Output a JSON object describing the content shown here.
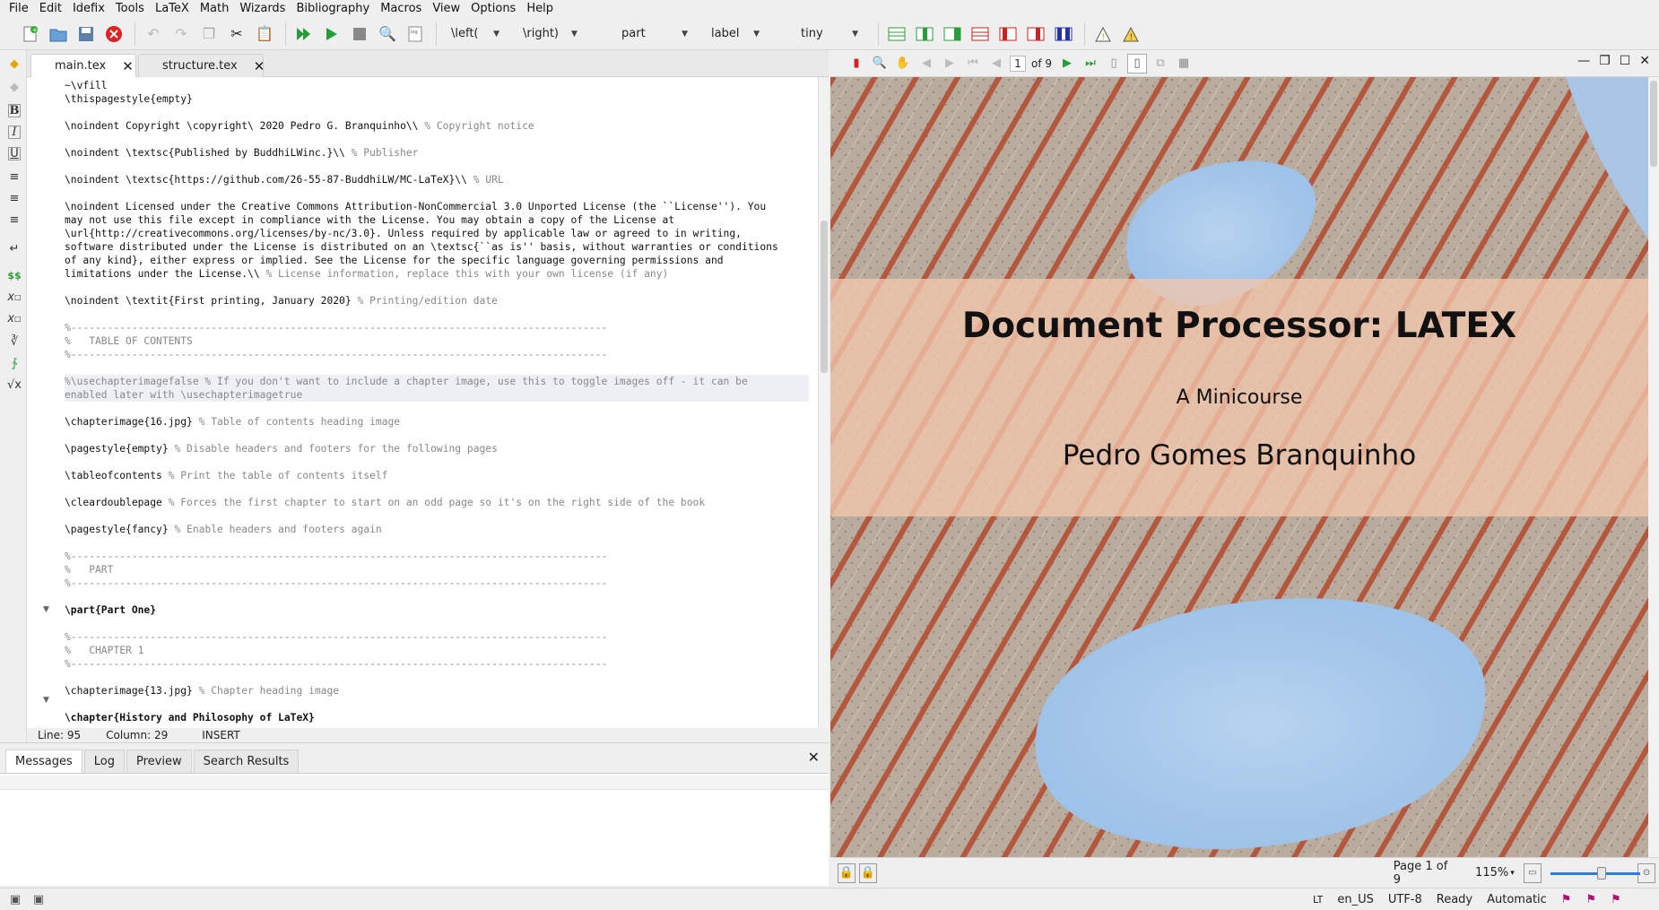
{
  "menu": [
    "File",
    "Edit",
    "Idefix",
    "Tools",
    "LaTeX",
    "Math",
    "Wizards",
    "Bibliography",
    "Macros",
    "View",
    "Options",
    "Help"
  ],
  "toolbar": {
    "combo_left": "\\left(",
    "combo_right": "\\right)",
    "combo_part": "part",
    "combo_label": "label",
    "combo_size": "tiny"
  },
  "tabs": [
    {
      "label": "main.tex"
    },
    {
      "label": "structure.tex"
    }
  ],
  "editor": {
    "lines": [
      {
        "t": "~\\vfill",
        "c": ""
      },
      {
        "t": "\\thispagestyle{empty}",
        "c": ""
      },
      {
        "t": "",
        "c": ""
      },
      {
        "t": "\\noindent Copyright \\copyright\\ 2020 Pedro G. Branquinho\\\\ ",
        "c": "% Copyright notice"
      },
      {
        "t": "",
        "c": ""
      },
      {
        "t": "\\noindent \\textsc{Published by BuddhiLWinc.}\\\\ ",
        "c": "% Publisher"
      },
      {
        "t": "",
        "c": ""
      },
      {
        "t": "\\noindent \\textsc{https://github.com/26-55-87-BuddhiLW/MC-LaTeX}\\\\ ",
        "c": "% URL"
      },
      {
        "t": "",
        "c": ""
      },
      {
        "t": "\\noindent Licensed under the Creative Commons Attribution-NonCommercial 3.0 Unported License (the ``License''). You",
        "c": ""
      },
      {
        "t": "may not use this file except in compliance with the License. You may obtain a copy of the License at",
        "c": ""
      },
      {
        "t": "\\url{http://creativecommons.org/licenses/by-nc/3.0}. Unless required by applicable law or agreed to in writing,",
        "c": ""
      },
      {
        "t": "software distributed under the License is distributed on an \\textsc{``as is'' basis, without warranties or conditions",
        "c": ""
      },
      {
        "t": "of any kind}, either express or implied. See the License for the specific language governing permissions and",
        "c": ""
      },
      {
        "t": "limitations under the License.\\\\ ",
        "c": "% License information, replace this with your own license (if any)"
      },
      {
        "t": "",
        "c": ""
      },
      {
        "t": "\\noindent \\textit{First printing, January 2020} ",
        "c": "% Printing/edition date"
      },
      {
        "t": "",
        "c": ""
      },
      {
        "t": "",
        "c": "%----------------------------------------------------------------------------------------"
      },
      {
        "t": "",
        "c": "%   TABLE OF CONTENTS"
      },
      {
        "t": "",
        "c": "%----------------------------------------------------------------------------------------"
      },
      {
        "t": "",
        "c": ""
      },
      {
        "t": "",
        "c": "%\\usechapterimagefalse % If you don't want to include a chapter image, use this to toggle images off - it can be",
        "hl": true
      },
      {
        "t": "",
        "c": "enabled later with \\usechapterimagetrue",
        "hl": true
      },
      {
        "t": "",
        "c": ""
      },
      {
        "t": "\\chapterimage{16.jpg} ",
        "c": "% Table of contents heading image"
      },
      {
        "t": "",
        "c": ""
      },
      {
        "t": "\\pagestyle{empty} ",
        "c": "% Disable headers and footers for the following pages"
      },
      {
        "t": "",
        "c": ""
      },
      {
        "t": "\\tableofcontents ",
        "c": "% Print the table of contents itself"
      },
      {
        "t": "",
        "c": ""
      },
      {
        "t": "\\cleardoublepage ",
        "c": "% Forces the first chapter to start on an odd page so it's on the right side of the book"
      },
      {
        "t": "",
        "c": ""
      },
      {
        "t": "\\pagestyle{fancy} ",
        "c": "% Enable headers and footers again"
      },
      {
        "t": "",
        "c": ""
      },
      {
        "t": "",
        "c": "%----------------------------------------------------------------------------------------"
      },
      {
        "t": "",
        "c": "%   PART"
      },
      {
        "t": "",
        "c": "%----------------------------------------------------------------------------------------"
      },
      {
        "t": "",
        "c": ""
      },
      {
        "t": "\\part{Part One}",
        "c": "",
        "bold": true
      },
      {
        "t": "",
        "c": ""
      },
      {
        "t": "",
        "c": "%----------------------------------------------------------------------------------------"
      },
      {
        "t": "",
        "c": "%   CHAPTER 1"
      },
      {
        "t": "",
        "c": "%----------------------------------------------------------------------------------------"
      },
      {
        "t": "",
        "c": ""
      },
      {
        "t": "\\chapterimage{13.jpg} ",
        "c": "% Chapter heading image"
      },
      {
        "t": "",
        "c": ""
      },
      {
        "t": "\\chapter{History and Philosophy of LaTeX}",
        "c": "",
        "bold": true
      }
    ]
  },
  "status": {
    "line": "Line: 95",
    "column": "Column: 29",
    "mode": "INSERT"
  },
  "bottom_tabs": [
    "Messages",
    "Log",
    "Preview",
    "Search Results"
  ],
  "pdf": {
    "page_input": "1",
    "page_of": "of 9",
    "title": "Document Processor: LATEX",
    "subtitle": "A Minicourse",
    "author": "Pedro Gomes Branquinho",
    "page_status": "Page 1 of 9",
    "zoom": "115%"
  },
  "statusbar": {
    "lt": "LT",
    "lang": "en_US",
    "encoding": "UTF-8",
    "state": "Ready",
    "mode": "Automatic"
  },
  "colors": {
    "accent": "#2a7de1",
    "link": "#0a52a6",
    "comment": "#888888"
  }
}
